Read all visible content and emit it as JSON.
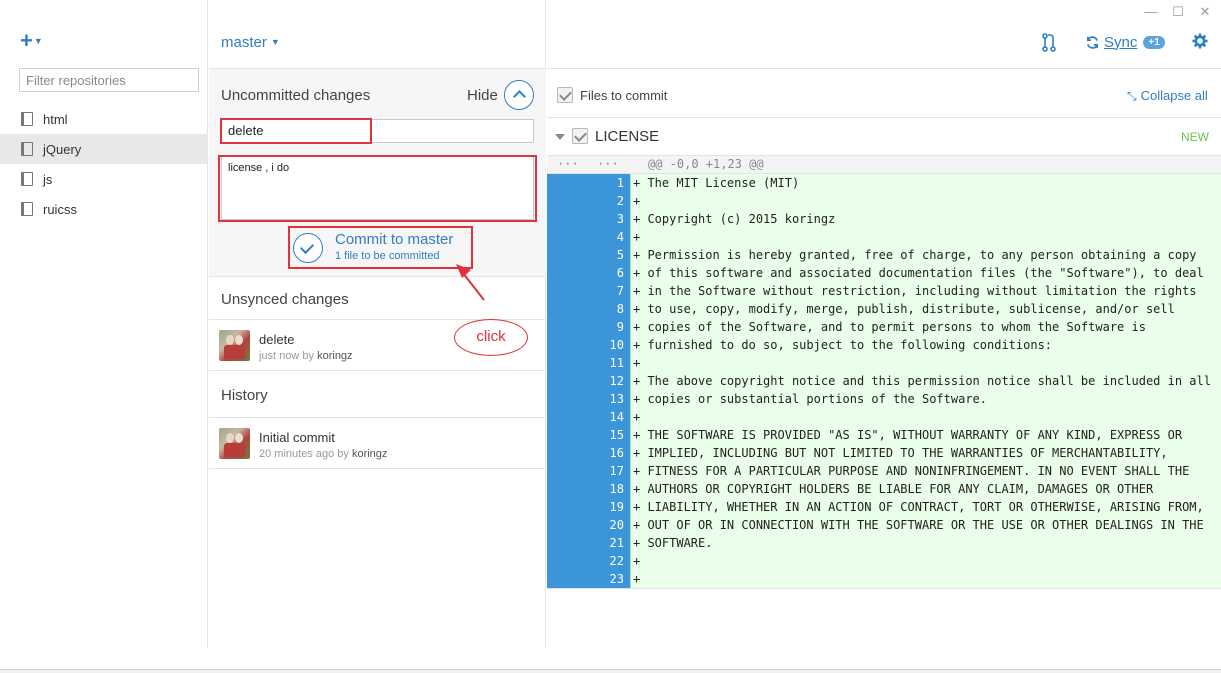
{
  "window": {
    "minimize": "—",
    "maximize": "☐",
    "close": "✕"
  },
  "sidebar": {
    "add_label": "+",
    "filter_placeholder": "Filter repositories",
    "repos": [
      {
        "label": "html",
        "selected": false
      },
      {
        "label": "jQuery",
        "selected": true
      },
      {
        "label": "js",
        "selected": false
      },
      {
        "label": "ruicss",
        "selected": false
      }
    ]
  },
  "toolbar": {
    "branch": "master",
    "sync_label": "Sync",
    "sync_badge": "+1",
    "icons": [
      "pull-request-icon",
      "sync-icon",
      "gear-icon"
    ]
  },
  "uncommitted": {
    "title": "Uncommitted changes",
    "hide_label": "Hide",
    "summary_value": "delete",
    "description_value": "license , i do",
    "commit_button_label": "Commit to master",
    "commit_button_sub": "1 file to be committed"
  },
  "unsynced": {
    "title": "Unsynced changes",
    "commits": [
      {
        "message": "delete",
        "time": "just now by",
        "author": "koringz"
      }
    ]
  },
  "history": {
    "title": "History",
    "commits": [
      {
        "message": "Initial commit",
        "time": "20 minutes ago by",
        "author": "koringz"
      }
    ]
  },
  "annotation": {
    "click_label": "click",
    "highlight_color": "#e0333c"
  },
  "files": {
    "label": "Files to commit",
    "collapse_label": "Collapse all",
    "file": {
      "name": "LICENSE",
      "status": "NEW"
    }
  },
  "diff": {
    "hunk_dots_old": "···",
    "hunk_dots_new": "···",
    "hunk_header": "@@ -0,0 +1,23 @@",
    "lines": [
      {
        "n": "1",
        "text": "+ The MIT License (MIT)"
      },
      {
        "n": "2",
        "text": "+"
      },
      {
        "n": "3",
        "text": "+ Copyright (c) 2015 koringz"
      },
      {
        "n": "4",
        "text": "+"
      },
      {
        "n": "5",
        "text": "+ Permission is hereby granted, free of charge, to any person obtaining a copy"
      },
      {
        "n": "6",
        "text": "+ of this software and associated documentation files (the \"Software\"), to deal"
      },
      {
        "n": "7",
        "text": "+ in the Software without restriction, including without limitation the rights"
      },
      {
        "n": "8",
        "text": "+ to use, copy, modify, merge, publish, distribute, sublicense, and/or sell"
      },
      {
        "n": "9",
        "text": "+ copies of the Software, and to permit persons to whom the Software is"
      },
      {
        "n": "10",
        "text": "+ furnished to do so, subject to the following conditions:"
      },
      {
        "n": "11",
        "text": "+"
      },
      {
        "n": "12",
        "text": "+ The above copyright notice and this permission notice shall be included in all"
      },
      {
        "n": "13",
        "text": "+ copies or substantial portions of the Software."
      },
      {
        "n": "14",
        "text": "+"
      },
      {
        "n": "15",
        "text": "+ THE SOFTWARE IS PROVIDED \"AS IS\", WITHOUT WARRANTY OF ANY KIND, EXPRESS OR"
      },
      {
        "n": "16",
        "text": "+ IMPLIED, INCLUDING BUT NOT LIMITED TO THE WARRANTIES OF MERCHANTABILITY,"
      },
      {
        "n": "17",
        "text": "+ FITNESS FOR A PARTICULAR PURPOSE AND NONINFRINGEMENT. IN NO EVENT SHALL THE"
      },
      {
        "n": "18",
        "text": "+ AUTHORS OR COPYRIGHT HOLDERS BE LIABLE FOR ANY CLAIM, DAMAGES OR OTHER"
      },
      {
        "n": "19",
        "text": "+ LIABILITY, WHETHER IN AN ACTION OF CONTRACT, TORT OR OTHERWISE, ARISING FROM,"
      },
      {
        "n": "20",
        "text": "+ OUT OF OR IN CONNECTION WITH THE SOFTWARE OR THE USE OR OTHER DEALINGS IN THE"
      },
      {
        "n": "21",
        "text": "+ SOFTWARE."
      },
      {
        "n": "22",
        "text": "+"
      },
      {
        "n": "23",
        "text": "+"
      }
    ]
  },
  "colors": {
    "accent": "#2f7ec6",
    "gutter": "#3b95d8",
    "added_bg": "#eaffea",
    "new_status": "#6cc644"
  }
}
